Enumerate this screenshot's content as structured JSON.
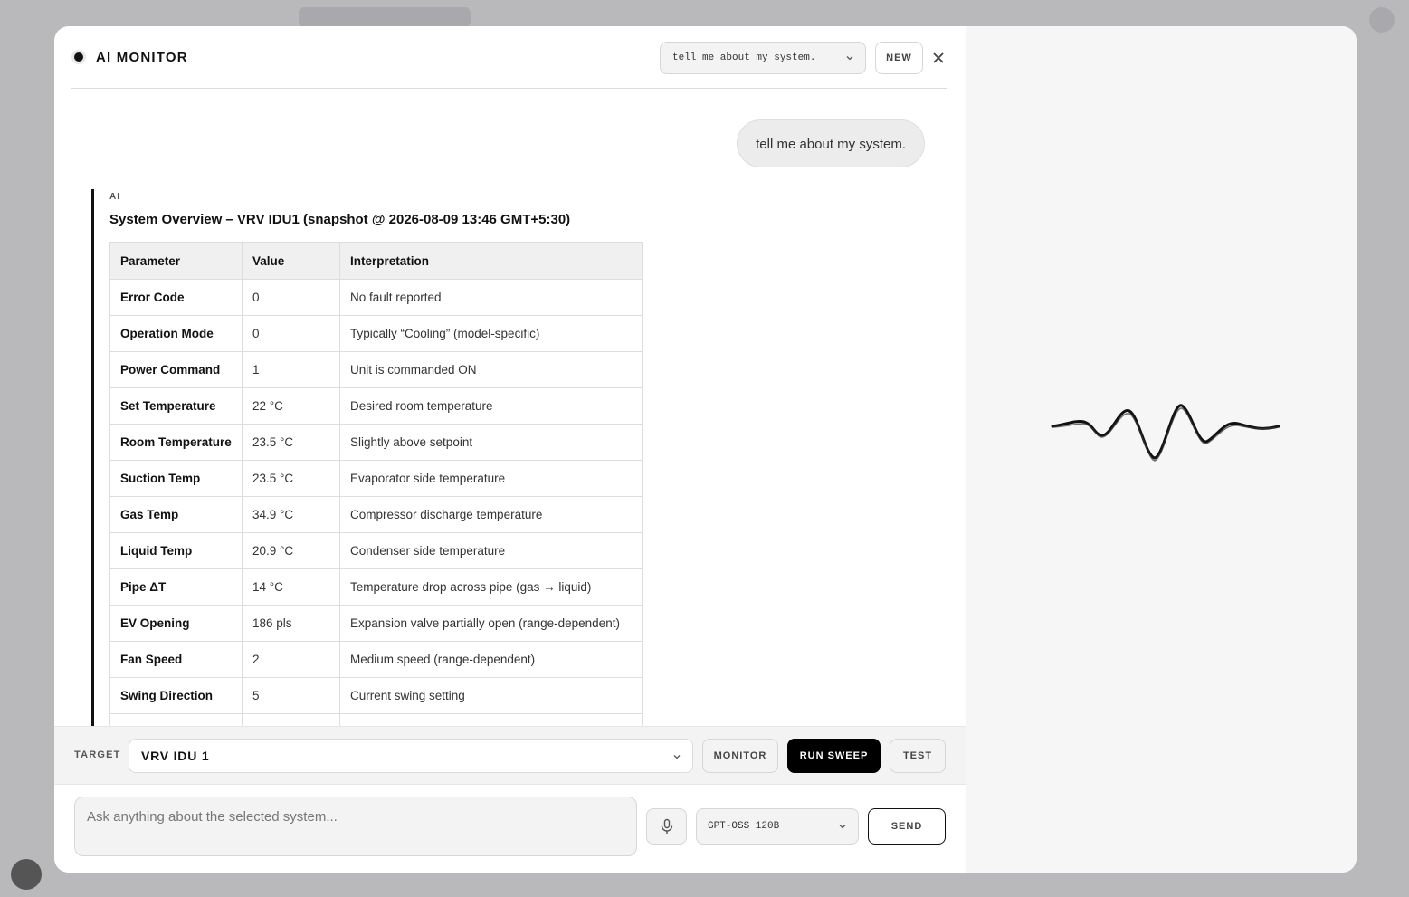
{
  "header": {
    "title": "AI MONITOR",
    "conversation_select": "tell me about my system.",
    "new_label": "NEW"
  },
  "chat": {
    "user_message": "tell me about my system.",
    "ai_label": "AI",
    "ai_heading": "System Overview – VRV IDU1 (snapshot @ 2026‑08‑09 13:46 GMT+5:30)",
    "table": {
      "columns": [
        "Parameter",
        "Value",
        "Interpretation"
      ],
      "rows": [
        [
          "Error Code",
          "0",
          "No fault reported"
        ],
        [
          "Operation Mode",
          "0",
          "Typically “Cooling” (model‑specific)"
        ],
        [
          "Power Command",
          "1",
          "Unit is commanded ON"
        ],
        [
          "Set Temperature",
          "22 °C",
          "Desired room temperature"
        ],
        [
          "Room Temperature",
          "23.5 °C",
          "Slightly above setpoint"
        ],
        [
          "Suction Temp",
          "23.5 °C",
          "Evaporator side temperature"
        ],
        [
          "Gas Temp",
          "34.9 °C",
          "Compressor discharge temperature"
        ],
        [
          "Liquid Temp",
          "20.9 °C",
          "Condenser side temperature"
        ],
        [
          "Pipe ΔT",
          "14 °C",
          "Temperature drop across pipe (gas → liquid)"
        ],
        [
          "EV Opening",
          "186 pls",
          "Expansion valve partially open (range‑dependent)"
        ],
        [
          "Fan Speed",
          "2",
          "Medium speed (range‑dependent)"
        ],
        [
          "Swing Direction",
          "5",
          "Current swing setting"
        ],
        [
          "",
          "",
          ""
        ]
      ]
    }
  },
  "target_bar": {
    "label": "TARGET",
    "selected": "VRV IDU 1",
    "monitor_label": "MONITOR",
    "run_sweep_label": "RUN SWEEP",
    "test_label": "TEST"
  },
  "input": {
    "placeholder": "Ask anything about the selected system...",
    "model": "GPT-OSS 120B",
    "send_label": "SEND"
  },
  "icons": {
    "status": "status-dot-icon",
    "chevron": "chevron-down-icon",
    "close": "close-icon",
    "mic": "microphone-icon",
    "waveform": "voice-waveform-icon"
  },
  "colors": {
    "accent": "#000000",
    "panel": "#f3f3f3",
    "background_overlay": "#b9b9bc"
  }
}
